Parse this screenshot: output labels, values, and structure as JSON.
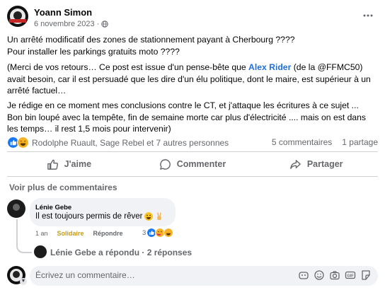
{
  "post": {
    "author": "Yoann Simon",
    "date": "6 novembre 2023",
    "separator": "·",
    "paragraphs": [
      "Un arrêté modificatif des zones de stationnement payant à Cherbourg ????",
      "Pour installer les parkings gratuits moto ????"
    ],
    "para2_prefix": "(Merci de vos retours… Ce post est issue d'un pense-bête que ",
    "para2_mention": "Alex Rider",
    "para2_suffix": " (de la @FFMC50) avait besoin, car il est persuadé que les dire d'un élu politique, dont le maire, est supérieur à un arrêté factuel…",
    "para3_line1": "Je rédige en ce moment mes conclusions contre le CT, et j'attaque les écritures à ce sujet ...",
    "para3_line2": "Bon bin  loupé avec la tempête, fin de semaine morte car plus d'électricité .... mais on est dans les temps… il rest 1,5 mois pour intervenir)"
  },
  "reactions": {
    "names": "Rodolphe Ruault, Sage Rebel et 7 autres personnes",
    "comments_count": "5 commentaires",
    "shares_count": "1 partage",
    "colors": {
      "like": "#1877f2",
      "laugh": "#f7b125"
    }
  },
  "actions": {
    "like": "J'aime",
    "comment": "Commenter",
    "share": "Partager"
  },
  "see_more": "Voir plus de commentaires",
  "comment": {
    "author": "Lénie Gebe",
    "text": "Il est toujours permis de rêver",
    "time": "1 an",
    "solidaire": "Solidaire",
    "reply": "Répondre",
    "reaction_count": "3"
  },
  "replies": {
    "text": "Lénie Gebe a répondu · 2 réponses"
  },
  "composer": {
    "placeholder": "Écrivez un commentaire…",
    "icons": [
      "avatar-sticker-icon",
      "emoji-icon",
      "camera-icon",
      "gif-icon",
      "sticker-icon"
    ]
  }
}
